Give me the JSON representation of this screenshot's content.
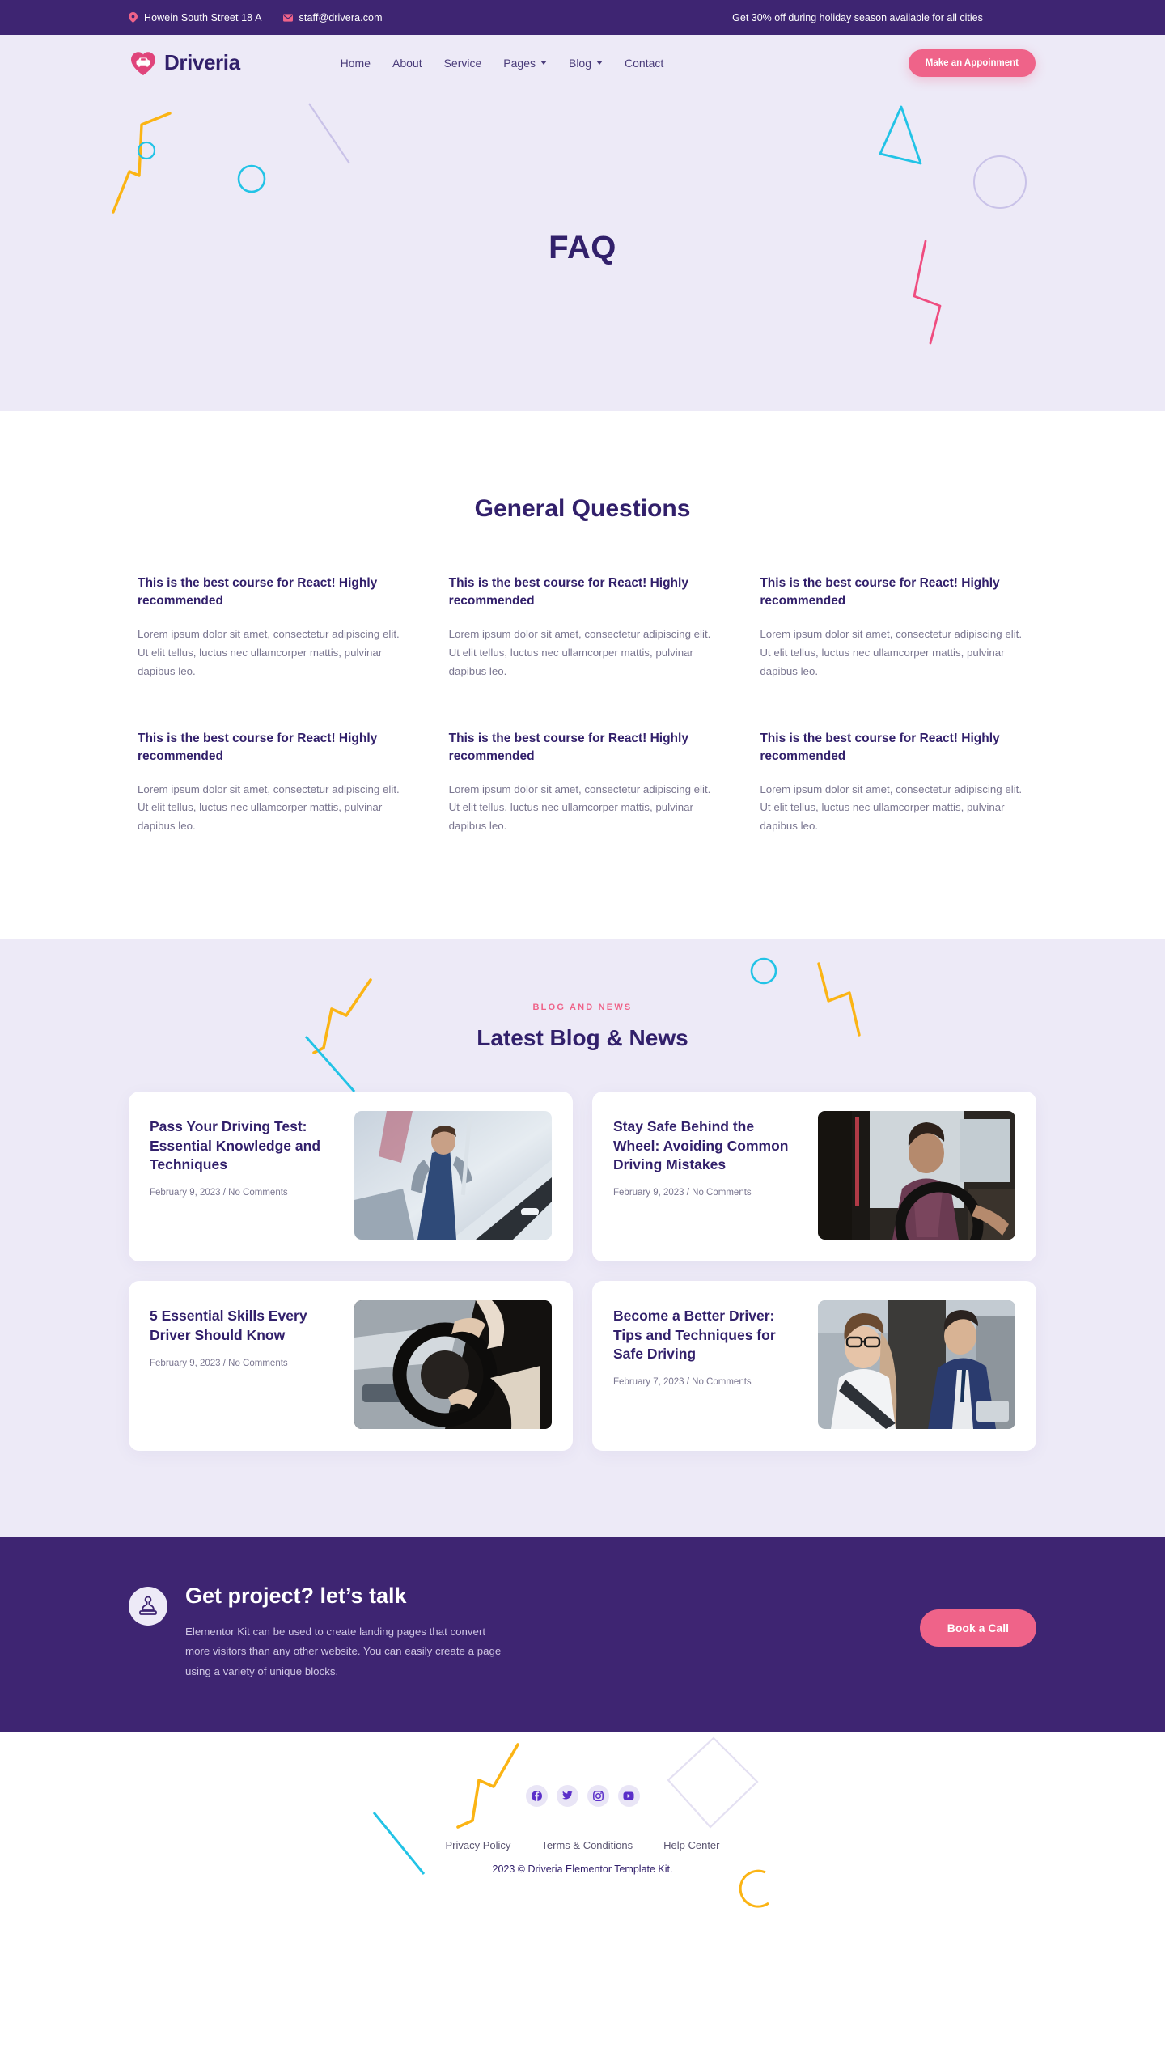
{
  "topbar": {
    "address": "Howein South Street 18 A",
    "address_icon": "location-pin-icon",
    "email": "staff@drivera.com",
    "email_icon": "envelope-icon",
    "promo": "Get 30% off during holiday season available for all cities",
    "background": "#3E2572"
  },
  "header": {
    "brand": "Driveria",
    "logo_icon": "heart-car-logo-icon",
    "nav": [
      {
        "label": "Home",
        "has_dropdown": false
      },
      {
        "label": "About",
        "has_dropdown": false
      },
      {
        "label": "Service",
        "has_dropdown": false
      },
      {
        "label": "Pages",
        "has_dropdown": true
      },
      {
        "label": "Blog",
        "has_dropdown": true
      },
      {
        "label": "Contact",
        "has_dropdown": false
      }
    ],
    "cta_label": "Make an Appoinment",
    "accent": "#EF6389",
    "background": "#EDEAF7"
  },
  "hero": {
    "title": "FAQ",
    "background": "#EDEAF7",
    "title_color": "#32206B"
  },
  "faq": {
    "title": "General Questions",
    "items": [
      {
        "question": "This is the best course for React! Highly recommended",
        "answer": "Lorem ipsum dolor sit amet, consectetur adipiscing elit. Ut elit tellus, luctus nec ullamcorper mattis, pulvinar dapibus leo."
      },
      {
        "question": "This is the best course for React! Highly recommended",
        "answer": "Lorem ipsum dolor sit amet, consectetur adipiscing elit. Ut elit tellus, luctus nec ullamcorper mattis, pulvinar dapibus leo."
      },
      {
        "question": "This is the best course for React! Highly recommended",
        "answer": "Lorem ipsum dolor sit amet, consectetur adipiscing elit. Ut elit tellus, luctus nec ullamcorper mattis, pulvinar dapibus leo."
      },
      {
        "question": "This is the best course for React! Highly recommended",
        "answer": "Lorem ipsum dolor sit amet, consectetur adipiscing elit. Ut elit tellus, luctus nec ullamcorper mattis, pulvinar dapibus leo."
      },
      {
        "question": "This is the best course for React! Highly recommended",
        "answer": "Lorem ipsum dolor sit amet, consectetur adipiscing elit. Ut elit tellus, luctus nec ullamcorper mattis, pulvinar dapibus leo."
      },
      {
        "question": "This is the best course for React! Highly recommended",
        "answer": "Lorem ipsum dolor sit amet, consectetur adipiscing elit. Ut elit tellus, luctus nec ullamcorper mattis, pulvinar dapibus leo."
      }
    ]
  },
  "blog": {
    "eyebrow": "BLOG AND NEWS",
    "heading": "Latest Blog & News",
    "eyebrow_color": "#EF6389",
    "background": "#EDEAF7",
    "posts": [
      {
        "title": "Pass Your Driving Test: Essential Knowledge and Techniques",
        "meta": "February 9, 2023 / No Comments",
        "image": "mechanic-inspecting-white-car-photo"
      },
      {
        "title": "Stay Safe Behind the Wheel: Avoiding Common Driving Mistakes",
        "meta": "February 9, 2023 / No Comments",
        "image": "woman-driving-car-interior-photo"
      },
      {
        "title": "5 Essential Skills Every Driver Should Know",
        "meta": "February 9, 2023 / No Comments",
        "image": "hands-on-steering-wheel-photo"
      },
      {
        "title": "Become a Better Driver: Tips and Techniques for Safe Driving",
        "meta": "February 7, 2023 / No Comments",
        "image": "instructor-and-student-seatbelt-photo"
      }
    ]
  },
  "cta": {
    "icon": "stamp-icon",
    "title": "Get project? let’s talk",
    "text": "Elementor Kit can be used to create landing pages that convert more visitors than any other website. You can easily create a page using a variety of unique blocks.",
    "button_label": "Book a Call",
    "background": "#3E2572",
    "button_color": "#EF6389"
  },
  "footer": {
    "social": [
      {
        "name": "facebook-icon",
        "label": "Facebook"
      },
      {
        "name": "twitter-icon",
        "label": "Twitter"
      },
      {
        "name": "instagram-icon",
        "label": "Instagram"
      },
      {
        "name": "youtube-icon",
        "label": "YouTube"
      }
    ],
    "links": [
      {
        "label": "Privacy Policy"
      },
      {
        "label": "Terms & Conditions"
      },
      {
        "label": "Help Center"
      }
    ],
    "copyright": "2023 © Driveria Elementor Template Kit."
  },
  "decor_colors": {
    "yellow": "#FBB414",
    "cyan": "#22C3E6",
    "pink": "#EF4C7F",
    "lavender": "#C9C2E8"
  }
}
